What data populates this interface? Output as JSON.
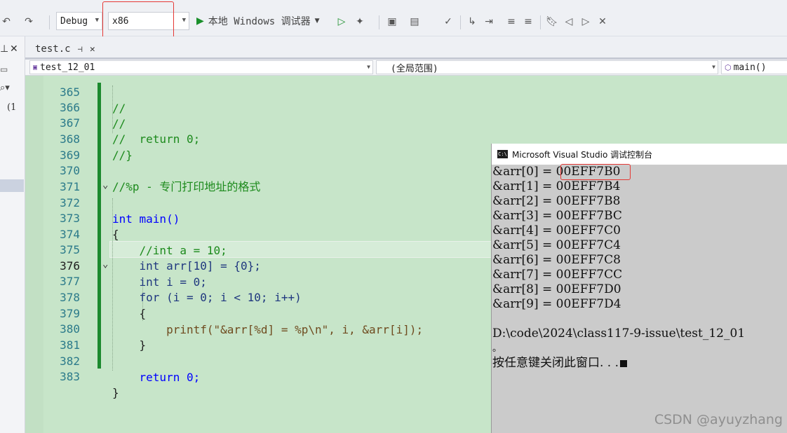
{
  "toolbar": {
    "config": "Debug",
    "platform": "x86",
    "run_label": "本地 Windows 调试器"
  },
  "left_panel": {
    "text": "(1"
  },
  "tab": {
    "name": "test.c",
    "pin_icon": "pin-icon",
    "close_icon": "close-icon"
  },
  "nav": {
    "project": "test_12_01",
    "scope": "(全局范围)",
    "function": "main()"
  },
  "editor": {
    "current_line": "376",
    "lines": [
      {
        "n": "365",
        "code": "//"
      },
      {
        "n": "366",
        "code": "//"
      },
      {
        "n": "367",
        "code": "//  return 0;"
      },
      {
        "n": "368",
        "code": "//}"
      },
      {
        "n": "369",
        "code": ""
      },
      {
        "n": "370",
        "code": "//%p - 专门打印地址的格式"
      },
      {
        "n": "371",
        "code": ""
      },
      {
        "n": "372",
        "code": "int main()"
      },
      {
        "n": "373",
        "code": "{"
      },
      {
        "n": "374",
        "code": "    //int a = 10;"
      },
      {
        "n": "375",
        "code": "    int arr[10] = {0};"
      },
      {
        "n": "376",
        "code": "    int i = 0;"
      },
      {
        "n": "377",
        "code": "    for (i = 0; i < 10; i++)"
      },
      {
        "n": "378",
        "code": "    {"
      },
      {
        "n": "379",
        "code": "        printf(\"&arr[%d] = %p\\n\", i, &arr[i]);"
      },
      {
        "n": "380",
        "code": "    }"
      },
      {
        "n": "381",
        "code": ""
      },
      {
        "n": "382",
        "code": "    return 0;"
      },
      {
        "n": "383",
        "code": "}"
      }
    ]
  },
  "console": {
    "title": "Microsoft Visual Studio 调试控制台",
    "icon_text": "C:\\",
    "lines": [
      "&arr[0] = 00EFF7B0",
      "&arr[1] = 00EFF7B4",
      "&arr[2] = 00EFF7B8",
      "&arr[3] = 00EFF7BC",
      "&arr[4] = 00EFF7C0",
      "&arr[5] = 00EFF7C4",
      "&arr[6] = 00EFF7C8",
      "&arr[7] = 00EFF7CC",
      "&arr[8] = 00EFF7D0",
      "&arr[9] = 00EFF7D4",
      "",
      "D:\\code\\2024\\class117-9-issue\\test_12_01",
      "。",
      "按任意键关闭此窗口. . ."
    ],
    "watermark": "CSDN @ayuyzhang"
  },
  "colors": {
    "editor_bg": "#c7e5c9",
    "highlight_red": "#e53935",
    "change_bar": "#1b8a2e"
  }
}
